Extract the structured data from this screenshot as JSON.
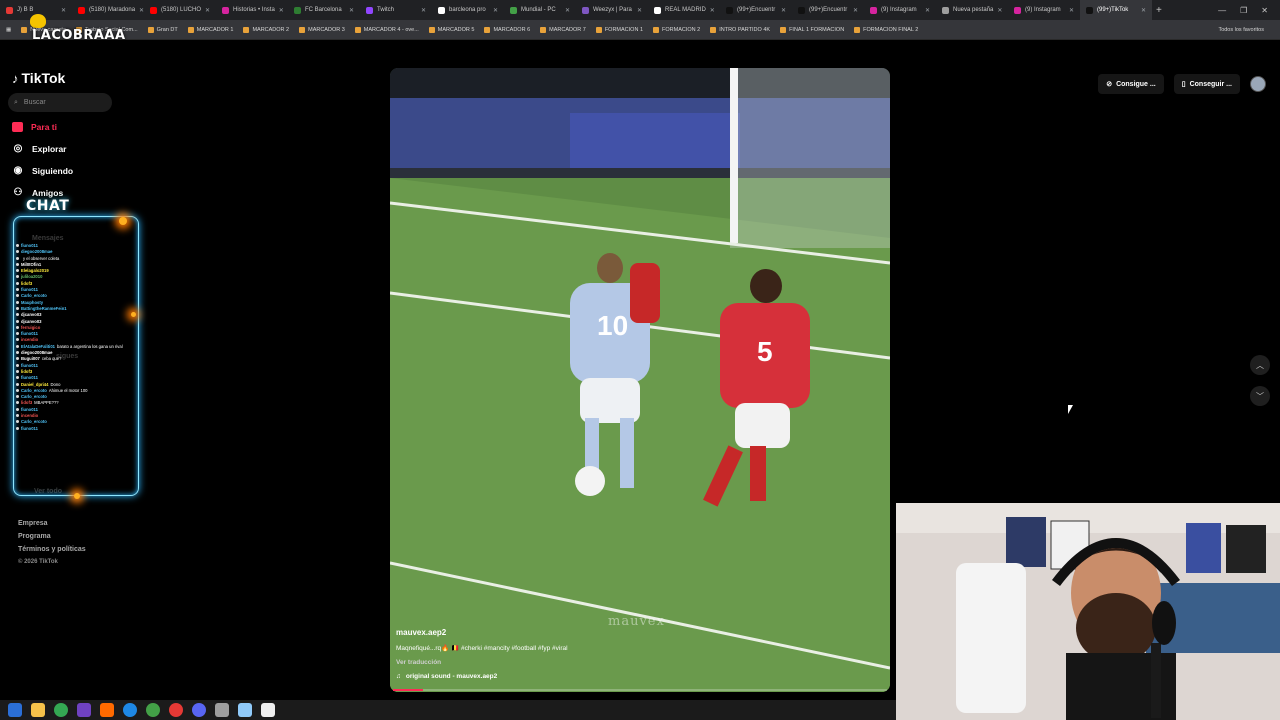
{
  "browser": {
    "tabs": [
      {
        "title": "J) B B",
        "color": "#e53935"
      },
      {
        "title": "(5180) Maradona",
        "color": "#ff0000"
      },
      {
        "title": "(5180) LUCHO",
        "color": "#ff0000"
      },
      {
        "title": "Historias • Insta",
        "color": "#d6249f"
      },
      {
        "title": "FC Barcelona",
        "color": "#2e7d32"
      },
      {
        "title": "Twitch",
        "color": "#9146ff"
      },
      {
        "title": "barcleona pro",
        "color": "#ffffff"
      },
      {
        "title": "Mundial - PC",
        "color": "#43a047"
      },
      {
        "title": "Weezyx | Para",
        "color": "#7e57c2"
      },
      {
        "title": "REAL MADRID",
        "color": "#ffffff"
      },
      {
        "title": "(99+)Encuentr",
        "color": "#111111"
      },
      {
        "title": "(99+)Encuentr",
        "color": "#111111"
      },
      {
        "title": "(9) Instagram",
        "color": "#d6249f"
      },
      {
        "title": "Nueva pestaña",
        "color": "#9e9e9e"
      },
      {
        "title": "(9) Instagram",
        "color": "#d6249f"
      },
      {
        "title": "(99+)TikTok",
        "color": "#111111"
      }
    ],
    "bookmarks": [
      "Nueva carpeta",
      "Trabajo Social Com...",
      "Gran DT",
      "MARCADOR 1",
      "MARCADOR 2",
      "MARCADOR 3",
      "MARCADOR 4 - ove...",
      "MARCADOR 5",
      "MARCADOR 6",
      "MARCADOR 7",
      "FORMACION 1",
      "FORMACION 2",
      "INTRO PARTIDO 4K",
      "FINAL 1 FORMACION",
      "FORMACION FINAL 2"
    ],
    "all_bookmarks": "Todos los favoritos"
  },
  "overlay": {
    "streamer": "LACOBRAAA",
    "chat_title": "CHAT"
  },
  "sidebar": {
    "logo": "TikTok",
    "search_placeholder": "Buscar",
    "nav": [
      {
        "label": "Para ti",
        "icon": "home-icon",
        "active": true
      },
      {
        "label": "Explorar",
        "icon": "compass-icon",
        "active": false
      },
      {
        "label": "Siguiendo",
        "icon": "following-icon",
        "active": false
      },
      {
        "label": "Amigos",
        "icon": "friends-icon",
        "active": false
      }
    ],
    "ghost_labels": [
      "Mensajes",
      "sigues",
      "Ver todo"
    ],
    "footer": [
      "Empresa",
      "Programa",
      "Términos y políticas",
      "© 2026 TikTok"
    ]
  },
  "chat": [
    {
      "user": "fiuno011",
      "msg": "",
      "color": "#4fc3f7"
    },
    {
      "user": "diegoo2008mae",
      "msg": "",
      "color": "#4fc3f7"
    },
    {
      "user": "",
      "msg": "y el observer coleta",
      "color": "#ffffff"
    },
    {
      "user": "Mil0tOfin1",
      "msg": "",
      "color": "#ffffff"
    },
    {
      "user": "Elelagalo2019",
      "msg": "",
      "color": "#ffeb3b"
    },
    {
      "user": "juliloa2010",
      "msg": "",
      "color": "#66bb6a"
    },
    {
      "user": "lidof3",
      "msg": "",
      "color": "#ffeb3b"
    },
    {
      "user": "fiuno011",
      "msg": "",
      "color": "#4fc3f7"
    },
    {
      "user": "Carlo_ercoto",
      "msg": "",
      "color": "#4fc3f7"
    },
    {
      "user": "Mauphosty",
      "msg": "",
      "color": "#4fc3f7"
    },
    {
      "user": "BattingtheRanmeFein1",
      "msg": "",
      "color": "#4fc3f7"
    },
    {
      "user": "djcanvo03",
      "msg": "",
      "color": "#ffffff"
    },
    {
      "user": "djcanvo03",
      "msg": "",
      "color": "#ffffff"
    },
    {
      "user": "ferruigico",
      "msg": "",
      "color": "#ef5350"
    },
    {
      "user": "fiuno011",
      "msg": "",
      "color": "#4fc3f7"
    },
    {
      "user": "incendio",
      "msg": "",
      "color": "#ef5350"
    },
    {
      "user": "ElAtalaDeFaliti01",
      "msg": "barato a argentina los gana un rival",
      "color": "#4fc3f7"
    },
    {
      "user": "diegoo2008mae",
      "msg": "",
      "color": "#ffffff"
    },
    {
      "user": "Bugui007",
      "msg": "ceba que?",
      "color": "#ffffff"
    },
    {
      "user": "fiuno011",
      "msg": "",
      "color": "#4fc3f7"
    },
    {
      "user": "lidof3",
      "msg": "",
      "color": "#ffeb3b"
    },
    {
      "user": "fiuno011",
      "msg": "",
      "color": "#4fc3f7"
    },
    {
      "user": "Daniel_dpri44",
      "msg": "Dono",
      "color": "#ffeb3b"
    },
    {
      "user": "Carlo_ercoto",
      "msg": "Ahimue el motor 100",
      "color": "#4fc3f7"
    },
    {
      "user": "Carlo_ercoto",
      "msg": "",
      "color": "#4fc3f7"
    },
    {
      "user": "lidof3",
      "msg": "MBAPPE???",
      "color": "#ef5350"
    },
    {
      "user": "fiuno011",
      "msg": "",
      "color": "#4fc3f7"
    },
    {
      "user": "incendio",
      "msg": "",
      "color": "#ef5350"
    },
    {
      "user": "Carlo_ercoto",
      "msg": "",
      "color": "#4fc3f7"
    },
    {
      "user": "fiuno011",
      "msg": "",
      "color": "#4fc3f7"
    }
  ],
  "video": {
    "username": "mauvex.aep2",
    "caption": "Maqnefiqué...rq🔥 🇧🇪 #cherki #mancity #football #fyp #viral",
    "translate": "Ver traducción",
    "sound": "original sound - mauvex.aep2",
    "watermark": "mauvex",
    "progress": 0.06,
    "player_numbers": [
      "10",
      "5"
    ]
  },
  "top_right": {
    "btn1": "Consigue ...",
    "btn2": "Conseguir ..."
  },
  "colors": {
    "accent": "#fe2c55",
    "chat_glow": "#2bb6ff"
  }
}
